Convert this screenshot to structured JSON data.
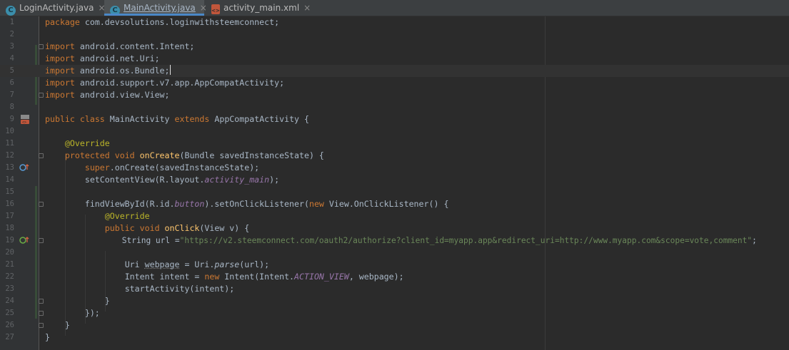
{
  "tabs": [
    {
      "label": "LoginActivity.java",
      "icon": "c-class-icon",
      "close": "×",
      "active": false
    },
    {
      "label": "MainActivity.java",
      "icon": "c-class-icon",
      "close": "×",
      "active": true
    },
    {
      "label": "activity_main.xml",
      "icon": "xml-layout-icon",
      "close": "×",
      "active": false
    }
  ],
  "line_numbers": [
    "1",
    "2",
    "3",
    "4",
    "5",
    "6",
    "7",
    "8",
    "9",
    "10",
    "11",
    "12",
    "13",
    "14",
    "15",
    "16",
    "17",
    "18",
    "19",
    "20",
    "21",
    "22",
    "23",
    "24",
    "25",
    "26",
    "27"
  ],
  "code": {
    "l1_kw": "package",
    "l1_rest": " com.devsolutions.loginwithsteemconnect;",
    "import_kw": "import",
    "l3_rest": " android.content.Intent;",
    "l4_rest": " android.net.Uri;",
    "l5_rest": " android.os.Bundle;",
    "l6_rest": " android.support.v7.app.AppCompatActivity;",
    "l7_rest": " android.view.View;",
    "l9_kw1": "public",
    "l9_kw2": "class",
    "l9_name": "MainActivity",
    "l9_kw3": "extends",
    "l9_rest": " AppCompatActivity {",
    "l11_ann": "@Override",
    "l12_kw1": "protected",
    "l12_kw2": "void",
    "l12_mth": "onCreate",
    "l12_rest": "(Bundle savedInstanceState) {",
    "l13_kw": "super",
    "l13_rest": ".onCreate(savedInstanceState);",
    "l14_pre": "setContentView(R.layout.",
    "l14_fld": "activity_main",
    "l14_post": ");",
    "l16_pre": "findViewById(R.id.",
    "l16_fld": "button",
    "l16_mid": ").setOnClickListener(",
    "l16_kw": "new",
    "l16_post": " View.OnClickListener() {",
    "l17_ann": "@Override",
    "l18_kw1": "public",
    "l18_kw2": "void",
    "l18_mth": "onClick",
    "l18_rest": "(View v) {",
    "l19_pre": "String url =",
    "l19_str": "\"https://v2.steemconnect.com/oauth2/authorize?client_id=myapp.app&redirect_uri=http://www.myapp.com&scope=vote,comment\"",
    "l19_post": ";",
    "l21_pre": "Uri ",
    "l21_var": "webpage",
    "l21_mid": " = Uri.",
    "l21_mth": "parse",
    "l21_post": "(url);",
    "l22_pre": "Intent intent = ",
    "l22_kw": "new",
    "l22_mid": " Intent(Intent.",
    "l22_cst": "ACTION_VIEW",
    "l22_post": ", webpage);",
    "l23": "startActivity(intent);",
    "l24": "}",
    "l25": "});",
    "l26": "}",
    "l27": "}"
  },
  "gutter_icons": {
    "l9": "class-layout-icon",
    "l12": "override-method-icon",
    "l18": "implement-method-icon"
  },
  "colors": {
    "background": "#2b2b2b",
    "keyword": "#cc7832",
    "annotation": "#bbb529",
    "string": "#6a8759",
    "field": "#9876aa",
    "method": "#ffc66d",
    "text": "#a9b7c6"
  }
}
